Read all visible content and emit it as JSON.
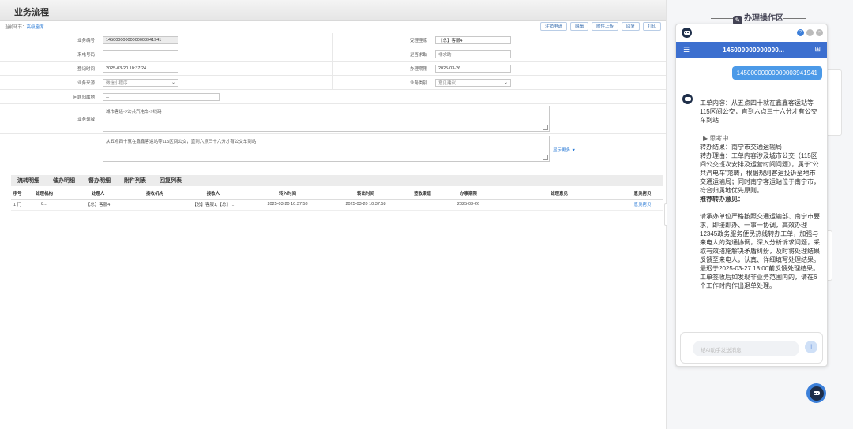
{
  "page": {
    "title": "业务流程"
  },
  "crumb": {
    "label": "当前环节：",
    "value": "高级座席"
  },
  "top_actions": [
    "注销申请",
    "编辑",
    "附件上传",
    "回复",
    "打印"
  ],
  "form": {
    "biz_no_label": "业务编号",
    "biz_no": "14500000000000003941941",
    "seat_label": "受理座席",
    "seat": "【总】客服4",
    "phone_label": "来电号码",
    "phone": "",
    "urgent_label": "是否求助",
    "urgent": "非求助",
    "reg_time_label": "登记时间",
    "reg_time": "2025-03-20 10:37:24",
    "deadline_label": "办理期限",
    "deadline": "2025-03-26",
    "source_label": "业务来源",
    "source": "微信小程序",
    "category_label": "业务类别",
    "category": "意见建议",
    "region_label": "问题归属地",
    "region": "...",
    "domain_label": "业务领域",
    "domain": "城市客运->公共汽电车->线路",
    "content": "从五点四十就在鑫鑫客运站等115区间公交，直到六点三十六分才有公交车到站",
    "show_more": "显示更多 ▼"
  },
  "tabs": [
    "流转明细",
    "催办明细",
    "督办明细",
    "附件列表",
    "回复列表"
  ],
  "table": {
    "headers": [
      "序号",
      "处理机构",
      "处理人",
      "接收机构",
      "接收人",
      "转入时间",
      "转出时间",
      "签收渠道",
      "办事期限",
      "处理意见",
      "意见拷贝"
    ],
    "rows": [
      [
        "1",
        "门",
        "8...",
        "【总】客服4",
        "",
        "【总】客服1,【总】...",
        "2025-03-20 10:37:58",
        "2025-03-20 10:37:58",
        "",
        "2025-03-26",
        "",
        "意见拷贝"
      ]
    ]
  },
  "panel": {
    "title": "办理操作区",
    "chat_title": "145000000000000...",
    "user_msg": "14500000000000003941941",
    "bot_content": "工单内容：从五点四十就在鑫鑫客运站等115区间公交，直到六点三十六分才有公交车到站",
    "thinking": "▶ 思考中...",
    "result": "转办结果：南宁市交通运输局",
    "reason": "转办理由：工单内容涉及城市公交（115区间公交班次安排及运营时间问题），属于“公共汽电车”范畴，根据规则客运投诉至地市交通运输局；同时南宁客运站位于南宁市，符合归属地优先原则。",
    "suggest_title": "推荐转办意见：",
    "suggest": "请承办单位严格按照交通运输部、南宁市要求，即接即办、一事一协调，高效办理12345政务服务便民热线转办工单，加强与来电人的沟通协调，深入分析诉求问题，采取有效措施解决矛盾纠纷，及时将处理结果反馈至来电人，认真、详细填写处理结果。最迟于2025-03-27 18:00前反馈处理结果。工单签收后如发现非业务范围内的，请在6个工作时内作出退单处理。",
    "input_placeholder": "给AI助手发送消息",
    "send": "↑"
  }
}
